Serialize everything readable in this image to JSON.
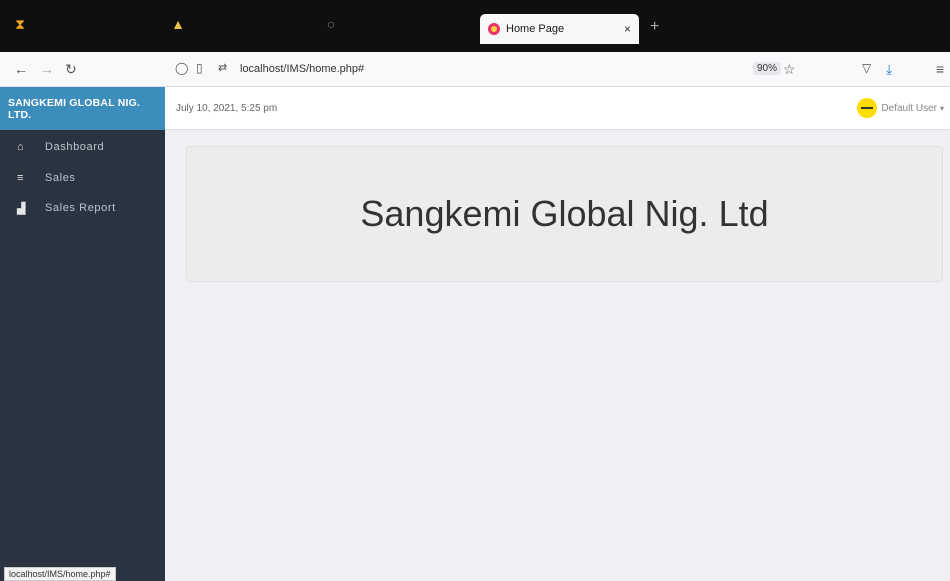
{
  "browser": {
    "tab_title": "Home Page",
    "tab_close": "×",
    "new_tab": "+",
    "url": "localhost/IMS/home.php#",
    "zoom": "90%",
    "status_url": "localhost/IMS/home.php#"
  },
  "sidebar": {
    "brand": "SANGKEMI GLOBAL NIG. LTD.",
    "items": [
      {
        "label": "Dashboard",
        "icon": "home-icon",
        "glyph": "⌂"
      },
      {
        "label": "Sales",
        "icon": "list-icon",
        "glyph": "≡"
      },
      {
        "label": "Sales Report",
        "icon": "bar-chart-icon",
        "glyph": "▟"
      }
    ]
  },
  "header": {
    "date": "July 10, 2021, 5:25 pm",
    "user": "Default User"
  },
  "main": {
    "hero_title": "Sangkemi Global Nig. Ltd"
  },
  "colors": {
    "brand": "#3c8dbc",
    "sidebar": "#2a3440",
    "background": "#eef0f4"
  }
}
